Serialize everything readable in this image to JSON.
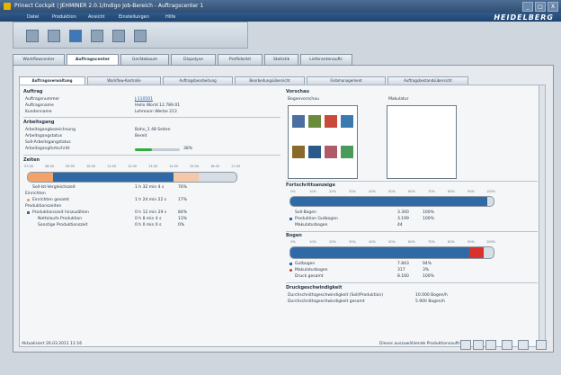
{
  "window": {
    "title": "Prinect Cockpit  |  JEHMINER 2.0.1/Indigo Job-Bereich - Auftragscenter 1",
    "controls": [
      "_",
      "□",
      "X"
    ]
  },
  "menubar": {
    "items": [
      "Datei",
      "Produktion",
      "Ansicht",
      "Einstellungen",
      "Hilfe"
    ],
    "brand": "HEIDELBERG"
  },
  "tabs": [
    "Workflowcenter",
    "Auftragscenter",
    "Gerätebaum",
    "Dispolyse",
    "Profildarkit",
    "Statistik",
    "Lieferantenauftr."
  ],
  "subtabs": [
    "Auftragsverwaltung",
    "Workflow-Kontrolle",
    "Auftragsbearbeitung",
    "Bearbeitungsübersicht",
    "Farbmanagement",
    "Auftragsbestandsübersicht",
    "Produktionsdaten-Übersicht"
  ],
  "left": {
    "auftrag": {
      "header": "Auftrag",
      "rows": [
        {
          "label": "Auftragsnummer",
          "value": "J-110501"
        },
        {
          "label": "Auftragsname",
          "value": "Hello World 12.789.01"
        },
        {
          "label": "Kundenname",
          "value": "Lehmann Werbe 213"
        }
      ]
    },
    "arbeitsgang": {
      "header": "Arbeitsgang",
      "rows": [
        {
          "label": "Arbeitsgangbezeichnung",
          "value": "Bahn_1 48 Seiten"
        },
        {
          "label": "Arbeitsgangstatus",
          "value": "Bereit"
        },
        {
          "label": "Soll-Arbeitsgangstatus",
          "value": ""
        },
        {
          "label": "Arbeitsgangfortschritt",
          "value": "38%"
        }
      ],
      "progress": 0.38
    },
    "zeiten": {
      "header": "Zeiten",
      "axis": [
        "07:00",
        "08:00",
        "09:00",
        "10:00",
        "11:00",
        "12:00",
        "13:00",
        "14:00",
        "15:00",
        "16:00",
        "17:00"
      ],
      "segments": [
        {
          "label": "Rüst",
          "value": 12,
          "color": "#f3a26a"
        },
        {
          "label": "Druck",
          "value": 58,
          "color": "#2f6aa6"
        },
        {
          "label": "Rest",
          "value": 12,
          "color": "#f5c9a8"
        }
      ],
      "rows": [
        {
          "label": "Soll-Ist-Vergleichszeit",
          "value": "1 h 32 min 4 s",
          "pct": "76%"
        },
        {
          "label": "Einrichten",
          "value": "",
          "pct": ""
        },
        {
          "label": "Einrichten gesamt",
          "value": "1 h 24 min 22 s",
          "pct": "17%"
        },
        {
          "label": "Produktionszeiten",
          "value": "",
          "pct": ""
        },
        {
          "label": "Produktionszeit hinzuzählen",
          "value": "0 h 12 min 29 s",
          "pct": "84%"
        },
        {
          "label": "Nettolaufe Produktion",
          "value": "0 h 8 min 4 s",
          "pct": "13%"
        },
        {
          "label": "Sonstige Produktionszeit",
          "value": "0 h 0 min 0 s",
          "pct": "0%"
        }
      ]
    }
  },
  "right": {
    "preview": {
      "header": "Vorschau",
      "label1": "Bogenvorschau",
      "label2": "Makulatur",
      "colors": [
        "#4a6fa0",
        "#6a8c3a",
        "#c94a3a",
        "#3a7ab0",
        "#8a6a2a",
        "#2a5a8a",
        "#b05a6a",
        "#4a9a5a"
      ]
    },
    "progress": {
      "header": "Fortschrittsanzeige",
      "axis": [
        "0%",
        "10%",
        "20%",
        "30%",
        "40%",
        "50%",
        "60%",
        "70%",
        "80%",
        "90%",
        "100%"
      ],
      "fill": 0.97,
      "rows": [
        {
          "label": "Soll-Bogen",
          "value": "3.300",
          "pct": "100%"
        },
        {
          "label": "Produktion Gutbogen",
          "value": "3.199",
          "pct": "100%"
        },
        {
          "label": "Makulaturbogen",
          "value": "44",
          "pct": ""
        }
      ]
    },
    "bogen": {
      "header": "Bogen",
      "axis": [
        "0%",
        "10%",
        "20%",
        "30%",
        "40%",
        "50%",
        "60%",
        "70%",
        "80%",
        "90%",
        "100%"
      ],
      "segments": [
        {
          "label": "Gut",
          "value": 88,
          "color": "#2f6aa6"
        },
        {
          "label": "Mak",
          "value": 7,
          "color": "#d9322a"
        }
      ],
      "rows": [
        {
          "label": "Gutbogen",
          "value": "7.843",
          "pct": "94%"
        },
        {
          "label": "Makulaturbogen",
          "value": "317",
          "pct": "3%"
        },
        {
          "label": "Druck gesamt",
          "value": "8.160",
          "pct": "100%"
        }
      ]
    },
    "geschwindigkeit": {
      "header": "Druckgeschwindigkeit",
      "rows": [
        {
          "label": "Durchschnittsgeschwindigkeit (Soll/Produktion)",
          "value": "10.000 Bogen/h"
        },
        {
          "label": "Durchschnittsgeschwindigkeit gesamt",
          "value": "5.900 Bogen/h"
        }
      ]
    }
  },
  "status": {
    "left": "Aktualisiert 26.03.2011 11:16",
    "right": "Dieses auszuwählende Produktionsaufträge"
  }
}
